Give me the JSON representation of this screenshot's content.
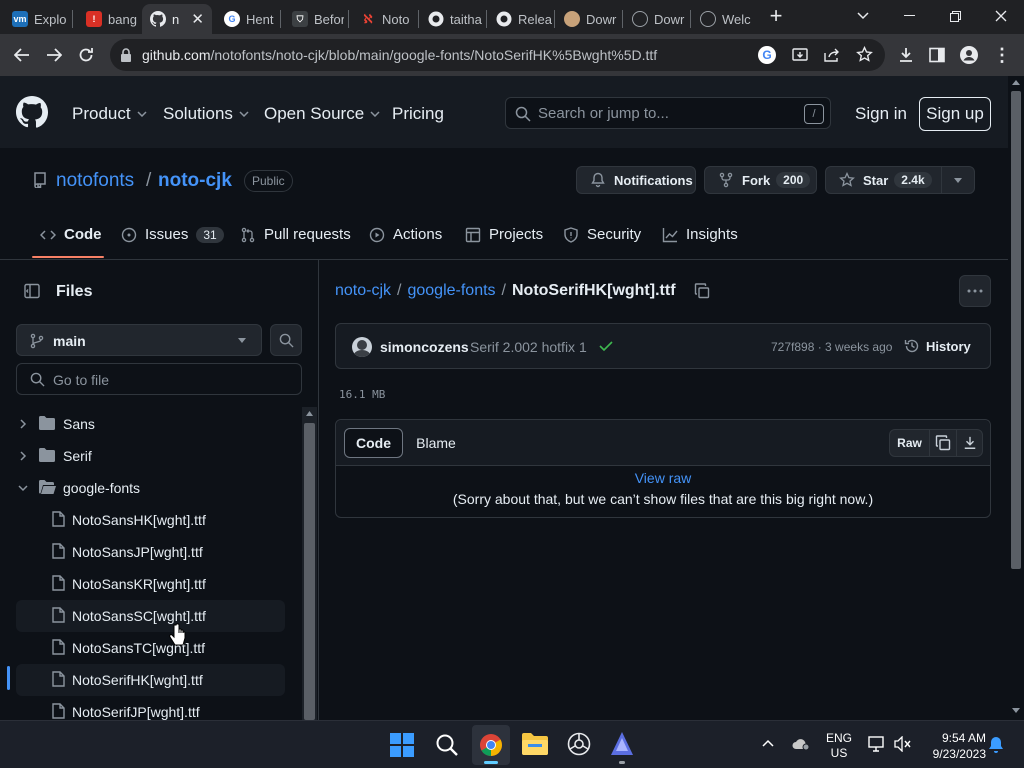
{
  "browser": {
    "tabs": [
      {
        "title": "Explo",
        "icon": "vmware-icon",
        "color": "#1d6fb8"
      },
      {
        "title": "bang",
        "icon": "bang-icon",
        "color": "#d93025"
      },
      {
        "title": "n",
        "icon": "github-icon",
        "color": "#ffffff"
      },
      {
        "title": "Hent",
        "icon": "google-icon",
        "color": "#ffffff"
      },
      {
        "title": "Befor",
        "icon": "shield-icon",
        "color": "#9aa0a6"
      },
      {
        "title": "Noto",
        "icon": "noto-icon",
        "color": "#ea4335"
      },
      {
        "title": "taitha",
        "icon": "github-icon",
        "color": "#ffffff"
      },
      {
        "title": "Relea",
        "icon": "github-icon",
        "color": "#ffffff"
      },
      {
        "title": "Dowr",
        "icon": "face-icon",
        "color": "#c8a27a"
      },
      {
        "title": "Dowr",
        "icon": "chrome-icon",
        "color": "#9aa0a6"
      },
      {
        "title": "Welc",
        "icon": "globe-icon",
        "color": "#9aa0a6"
      }
    ],
    "url_host": "github.com",
    "url_path": "/notofonts/noto-cjk/blob/main/google-fonts/NotoSerifHK%5Bwght%5D.ttf"
  },
  "github_header": {
    "nav": [
      "Product",
      "Solutions",
      "Open Source",
      "Pricing"
    ],
    "search_placeholder": "Search or jump to...",
    "search_shortcut": "/",
    "sign_in": "Sign in",
    "sign_up": "Sign up"
  },
  "repo": {
    "owner": "notofonts",
    "separator": "/",
    "name": "noto-cjk",
    "visibility": "Public",
    "notifications": "Notifications",
    "fork_label": "Fork",
    "fork_count": "200",
    "star_label": "Star",
    "star_count": "2.4k",
    "tabs": [
      {
        "label": "Code",
        "count": ""
      },
      {
        "label": "Issues",
        "count": "31"
      },
      {
        "label": "Pull requests",
        "count": ""
      },
      {
        "label": "Actions",
        "count": ""
      },
      {
        "label": "Projects",
        "count": ""
      },
      {
        "label": "Security",
        "count": ""
      },
      {
        "label": "Insights",
        "count": ""
      }
    ]
  },
  "sidebar": {
    "title": "Files",
    "branch": "main",
    "goto_placeholder": "Go to file",
    "tree": [
      {
        "name": "Sans",
        "type": "folder",
        "expanded": false
      },
      {
        "name": "Serif",
        "type": "folder",
        "expanded": false
      },
      {
        "name": "google-fonts",
        "type": "folder",
        "expanded": true
      },
      {
        "name": "NotoSansHK[wght].ttf",
        "type": "file"
      },
      {
        "name": "NotoSansJP[wght].ttf",
        "type": "file"
      },
      {
        "name": "NotoSansKR[wght].ttf",
        "type": "file"
      },
      {
        "name": "NotoSansSC[wght].ttf",
        "type": "file"
      },
      {
        "name": "NotoSansTC[wght].ttf",
        "type": "file"
      },
      {
        "name": "NotoSerifHK[wght].ttf",
        "type": "file"
      },
      {
        "name": "NotoSerifJP[wght].ttf",
        "type": "file"
      }
    ]
  },
  "file": {
    "crumb_repo": "noto-cjk",
    "crumb_dir": "google-fonts",
    "crumb_file": "NotoSerifHK[wght].ttf",
    "slash": "/",
    "author": "simoncozens",
    "commit_message": "Serif 2.002 hotfix 1",
    "commit_meta": "727f898 · 3 weeks ago",
    "history": "History",
    "size": "16.1 MB",
    "view_code": "Code",
    "view_blame": "Blame",
    "raw": "Raw",
    "view_raw_link": "View raw",
    "too_big_message": "(Sorry about that, but we can’t show files that are this big right now.)"
  },
  "taskbar": {
    "lang_top": "ENG",
    "lang_bottom": "US",
    "time": "9:54 AM",
    "date": "9/23/2023"
  },
  "colors": {
    "bg": "#0d1117",
    "header": "#161b22",
    "link": "#4493f8",
    "accent_underline": "#f78166",
    "border": "#30363d",
    "muted": "#8b949e",
    "check": "#3fb950"
  }
}
